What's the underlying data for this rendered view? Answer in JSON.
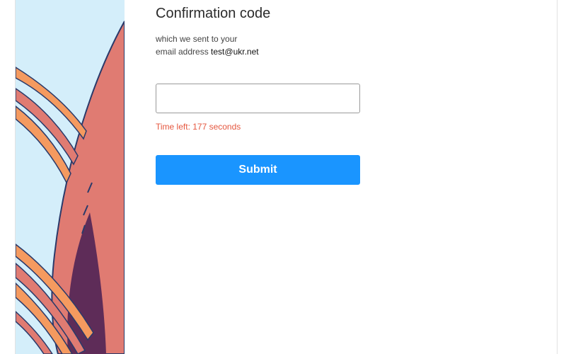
{
  "form": {
    "title": "Confirmation code",
    "description_line1": "which we sent to your",
    "description_line2_prefix": "email address",
    "email": "test@ukr.net",
    "code_value": "",
    "time_left_text": "Time left: 177 seconds",
    "submit_label": "Submit"
  },
  "colors": {
    "accent": "#1a95ff",
    "timer": "#e5573f",
    "art_sky": "#d4eefa",
    "art_coral": "#e07b72",
    "art_orange": "#f59a5f",
    "art_navy": "#2a3a6a",
    "art_plum": "#5e2c58"
  }
}
